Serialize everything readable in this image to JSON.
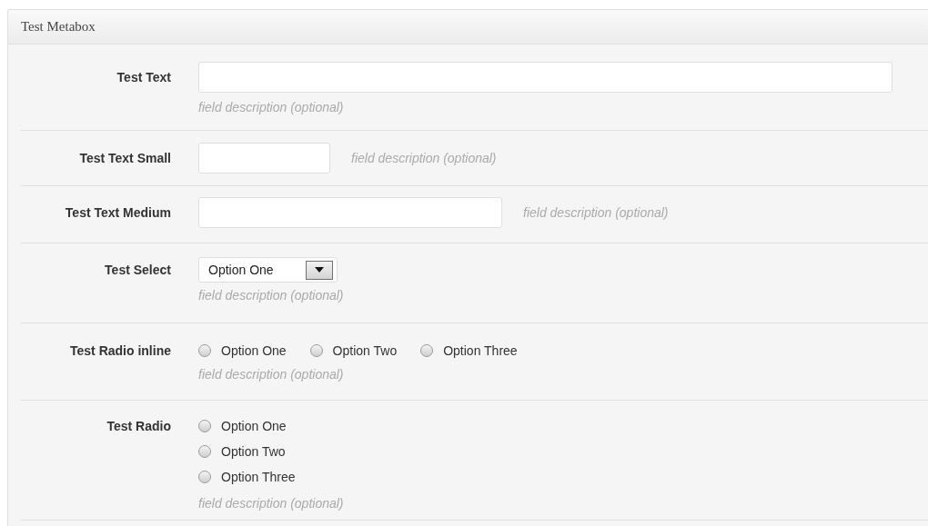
{
  "metabox": {
    "title": "Test Metabox",
    "fields": [
      {
        "kind": "longtext",
        "label": "Test Text",
        "description": "field description (optional)"
      },
      {
        "kind": "shorttext",
        "label": "Test Text Small",
        "description": "field description (optional)"
      },
      {
        "kind": "mediumtext",
        "label": "Test Text Medium",
        "description": "field description (optional)"
      },
      {
        "kind": "select",
        "label": "Test Select",
        "value": "Option One",
        "description": "field description (optional)"
      },
      {
        "kind": "radiorow",
        "label": "Test Radio inline",
        "options": [
          {
            "label": "Option One",
            "selected": false
          },
          {
            "label": "Option Two",
            "selected": false
          },
          {
            "label": "Option Three",
            "selected": false
          }
        ],
        "description": "field description (optional)"
      },
      {
        "kind": "radiolist",
        "label": "Test Radio",
        "options": [
          {
            "label": "Option One",
            "selected": false
          },
          {
            "label": "Option Two",
            "selected": false
          },
          {
            "label": "Option Three",
            "selected": false
          }
        ],
        "description": "field description (optional)"
      }
    ]
  }
}
